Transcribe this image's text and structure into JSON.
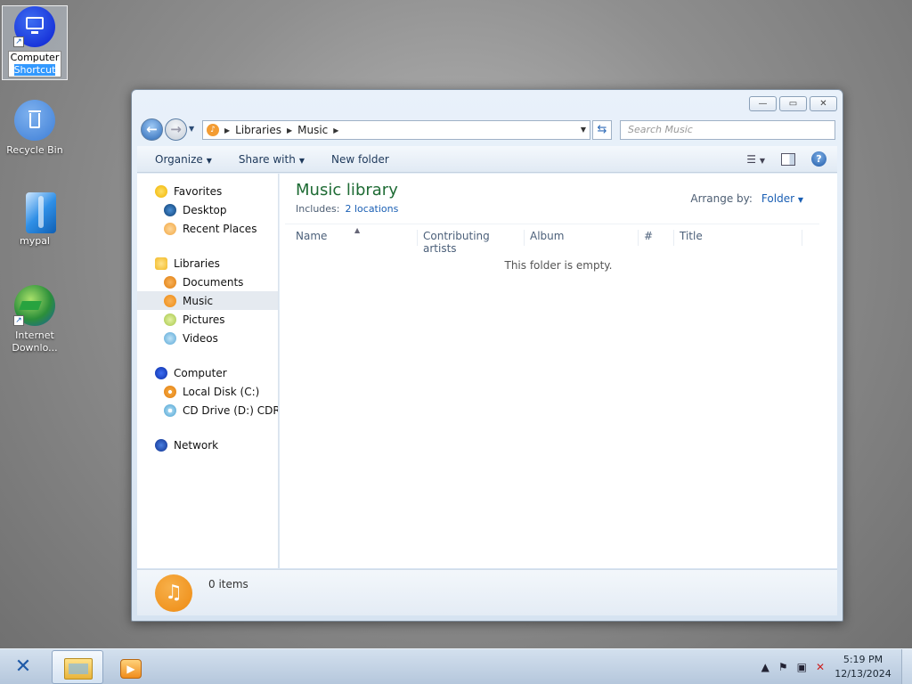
{
  "desktop": {
    "icons": [
      {
        "line1": "Computer",
        "line2": "Shortcut",
        "selected": true
      },
      {
        "line1": "Recycle Bin"
      },
      {
        "line1": "mypal"
      },
      {
        "line1": "Internet",
        "line2": "Downlo..."
      }
    ]
  },
  "window": {
    "caption_buttons": {
      "minimize": "—",
      "maximize": "▭",
      "close": "✕"
    },
    "nav": {
      "back": "←",
      "forward": "→"
    },
    "address": {
      "segments": [
        "Libraries",
        "Music"
      ]
    },
    "search": {
      "placeholder": "Search Music"
    },
    "toolbar": {
      "organize": "Organize",
      "share_with": "Share with",
      "new_folder": "New folder"
    },
    "nav_pane": {
      "groups": [
        {
          "root": "Favorites",
          "children": [
            "Desktop",
            "Recent Places"
          ]
        },
        {
          "root": "Libraries",
          "children": [
            "Documents",
            "Music",
            "Pictures",
            "Videos"
          ]
        },
        {
          "root": "Computer",
          "children": [
            "Local Disk (C:)",
            "CD Drive (D:) CDROM"
          ]
        },
        {
          "root": "Network",
          "children": []
        }
      ],
      "selected": "Music"
    },
    "content": {
      "title": "Music library",
      "includes_label": "Includes:",
      "includes_link": "2 locations",
      "arrange_label": "Arrange by:",
      "arrange_value": "Folder",
      "columns": [
        "Name",
        "Contributing artists",
        "Album",
        "#",
        "Title"
      ],
      "empty_message": "This folder is empty."
    },
    "details": {
      "count": "0 items"
    }
  },
  "taskbar": {
    "clock_time": "5:19 PM",
    "clock_date": "12/13/2024"
  },
  "colors": {
    "library_title": "#1e6b34",
    "link": "#1a5fb4",
    "music_accent": "#ee8a11"
  }
}
